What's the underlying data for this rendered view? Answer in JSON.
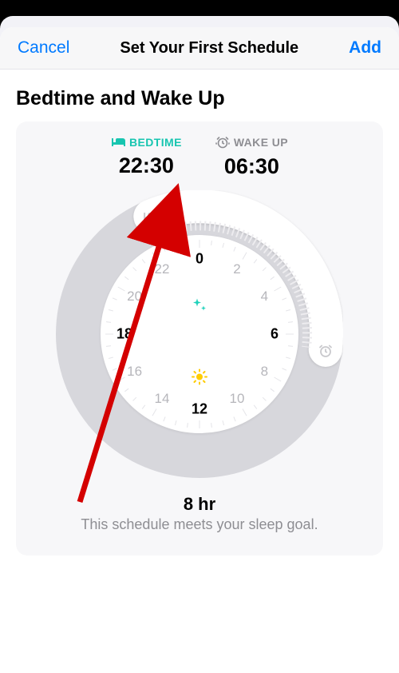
{
  "nav": {
    "cancel": "Cancel",
    "title": "Set Your First Schedule",
    "add": "Add"
  },
  "section": {
    "title": "Bedtime and Wake Up"
  },
  "times": {
    "bedtime_label": "BEDTIME",
    "bedtime_value": "22:30",
    "wakeup_label": "WAKE UP",
    "wakeup_value": "06:30"
  },
  "dial": {
    "hours": [
      "0",
      "2",
      "4",
      "6",
      "8",
      "10",
      "12",
      "14",
      "16",
      "18",
      "20",
      "22"
    ],
    "bold_hours": [
      "0",
      "6",
      "12",
      "18"
    ],
    "bedtime_angle_deg": -22.5,
    "wakeup_angle_deg": 97.5
  },
  "summary": {
    "duration": "8 hr",
    "message": "This schedule meets your sleep goal."
  },
  "colors": {
    "accent": "#007aff",
    "teal": "#17c5b0",
    "gray": "#8e8e93"
  }
}
